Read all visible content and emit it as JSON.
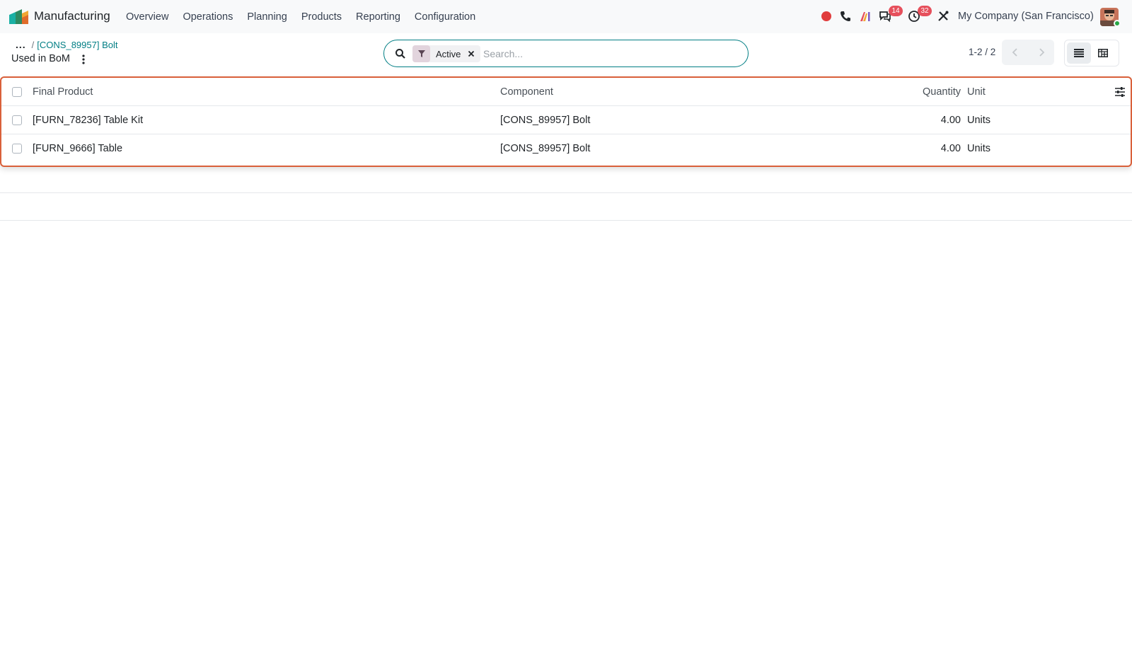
{
  "navbar": {
    "app_name": "Manufacturing",
    "menu": [
      "Overview",
      "Operations",
      "Planning",
      "Products",
      "Reporting",
      "Configuration"
    ],
    "messages_badge": "14",
    "activities_badge": "32",
    "company": "My Company (San Francisco)"
  },
  "control_panel": {
    "breadcrumb_dots": "...",
    "breadcrumb_link": "[CONS_89957] Bolt",
    "title": "Used in BoM",
    "search": {
      "facet_label": "Active",
      "placeholder": "Search..."
    },
    "pager": "1-2 / 2"
  },
  "table": {
    "headers": {
      "final_product": "Final Product",
      "component": "Component",
      "quantity": "Quantity",
      "unit": "Unit"
    },
    "rows": [
      {
        "final_product": "[FURN_78236] Table Kit",
        "component": "[CONS_89957] Bolt",
        "quantity": "4.00",
        "unit": "Units"
      },
      {
        "final_product": "[FURN_9666] Table",
        "component": "[CONS_89957] Bolt",
        "quantity": "4.00",
        "unit": "Units"
      }
    ]
  },
  "colors": {
    "accent": "#017e84",
    "highlight_border": "#d9603a",
    "badge": "#e6505c",
    "recording_dot": "#e03c3c"
  }
}
